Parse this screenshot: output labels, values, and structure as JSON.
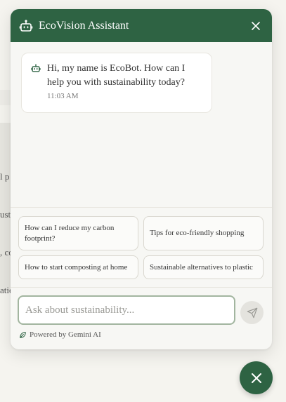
{
  "background": {
    "fragments": [
      "l p",
      "usta",
      ", co",
      "atio"
    ]
  },
  "chat": {
    "title": "EcoVision Assistant",
    "colors": {
      "brand": "#2e6343",
      "accent_border": "#a2b59f"
    },
    "icons": {
      "header": "robot-icon",
      "close": "close-icon",
      "send": "send-icon",
      "powered": "leaf-icon",
      "fab": "close-icon"
    },
    "messages": [
      {
        "text": "Hi, my name is EcoBot. How can I help you with sustainability today?",
        "time": "11:03 AM"
      }
    ],
    "suggestions": [
      "How can I reduce my carbon footprint?",
      "Tips for eco-friendly shopping",
      "How to start composting at home",
      "Sustainable alternatives to plastic"
    ],
    "input": {
      "placeholder": "Ask about sustainability...",
      "value": ""
    },
    "powered_by": "Powered by Gemini AI"
  }
}
